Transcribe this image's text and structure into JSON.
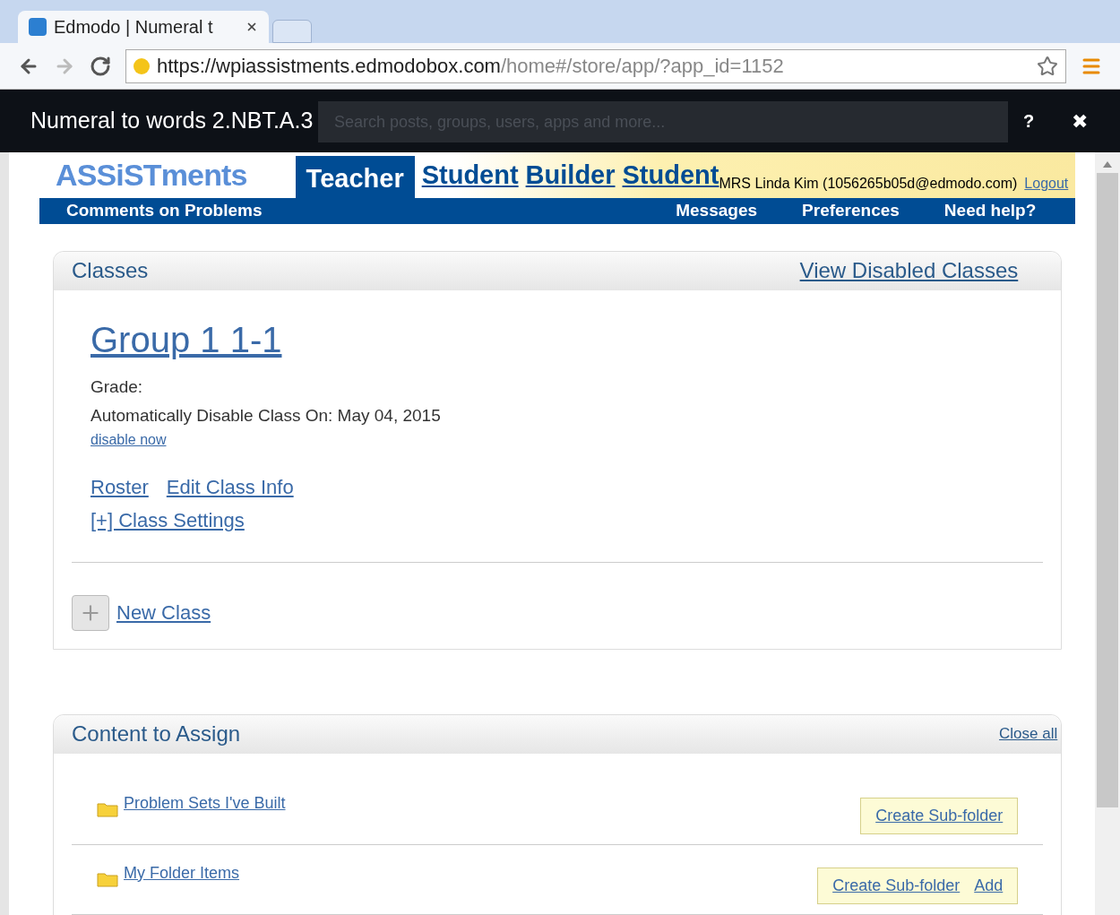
{
  "browser": {
    "tab_title": "Edmodo | Numeral t",
    "url_host": "https://wpiassistments.edmodobox.com",
    "url_path": "/home#/store/app/?app_id=1152"
  },
  "app_header": {
    "title": "Numeral to words 2.NBT.A.3",
    "search": {
      "placeholder": "Search posts, groups, users, apps and more..."
    },
    "help": "?",
    "close": "✖"
  },
  "site": {
    "logo": "ASSiSTments",
    "tabs": [
      {
        "label": "Teacher",
        "selected": true
      },
      {
        "label": "Student",
        "selected": false
      }
    ],
    "overlapping_tabs": [
      "Builder",
      "Student"
    ],
    "user": "MRS Linda Kim (1056265b05d@edmodo.com)",
    "logout": "Logout"
  },
  "nav": {
    "left": [
      "Comments on Problems"
    ],
    "right": [
      "Messages",
      "Preferences",
      "Need help?"
    ]
  },
  "classes": {
    "title": "Classes",
    "link": "View Disabled Classes",
    "group": {
      "name": "Group 1 1-1",
      "grade": "Grade:",
      "disable_on": "Automatically Disable Class On: May 04, 2015",
      "disable_now": "disable now",
      "links": [
        "Roster",
        "Edit Class Info",
        "[+] Class Settings"
      ]
    },
    "new_class": "New Class"
  },
  "content": {
    "title": "Content to Assign",
    "close_all": "Close all",
    "folders": [
      {
        "name": "Problem Sets I've Built",
        "actions": [
          "Create Sub-folder"
        ]
      },
      {
        "name": "My Folder Items",
        "actions": [
          "Create Sub-folder",
          "Add"
        ]
      }
    ]
  }
}
